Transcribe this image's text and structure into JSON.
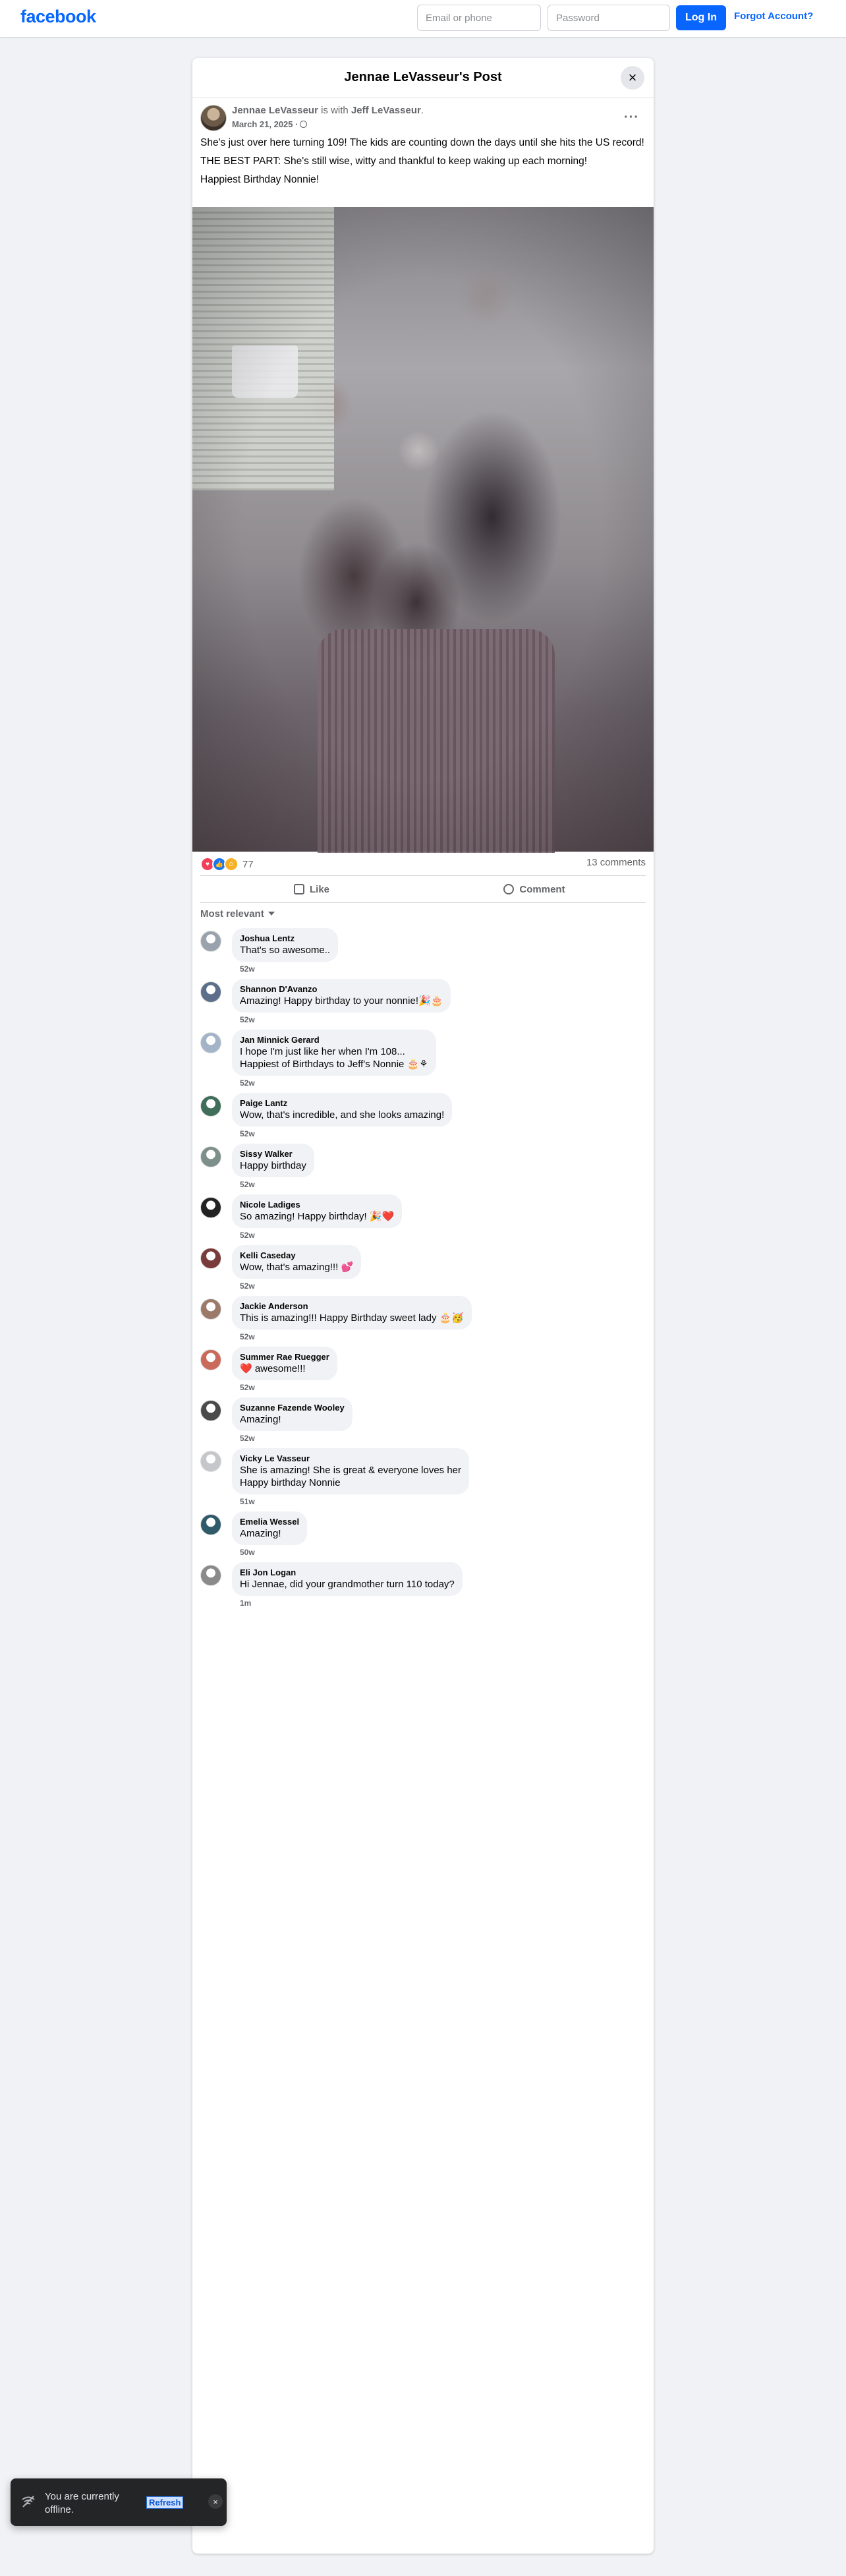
{
  "topbar": {
    "logo": "facebook",
    "email_placeholder": "Email or phone",
    "password_placeholder": "Password",
    "login_label": "Log In",
    "forgot_label": "Forgot Account?"
  },
  "post": {
    "header_title": "Jennae LeVasseur's Post",
    "close_icon": "×",
    "author": "Jennae LeVasseur",
    "with_text": " is with ",
    "tagged": "Jeff LeVasseur",
    "period": ".",
    "date": "March 21, 2025 ·",
    "more_icon": "···",
    "text_1": "She's just over here turning 109!  The kids are counting down the days until she hits the US record!",
    "text_2": "THE BEST PART: She's still wise, witty and thankful to keep waking up each morning!",
    "text_3": "Happiest Birthday Nonnie!",
    "reaction_count": "77",
    "comments_count": "13 comments",
    "like_label": "Like",
    "comment_label": "Comment",
    "sort_label": "Most relevant"
  },
  "comments": [
    {
      "name": "Joshua Lentz",
      "text": "That's so awesome..",
      "time": "52w"
    },
    {
      "name": "Shannon D'Avanzo",
      "text": "Amazing! Happy birthday to your nonnie!🎉🎂",
      "time": "52w"
    },
    {
      "name": "Jan Minnick Gerard",
      "text": "I hope I'm just like her when I'm 108...\nHappiest of Birthdays to Jeff's Nonnie 🎂⚘",
      "time": "52w"
    },
    {
      "name": "Paige Lantz",
      "text": "Wow, that's incredible, and she looks amazing!",
      "time": "52w"
    },
    {
      "name": "Sissy Walker",
      "text": "Happy birthday",
      "time": "52w"
    },
    {
      "name": "Nicole Ladiges",
      "text": "So amazing! Happy birthday! 🎉❤️",
      "time": "52w"
    },
    {
      "name": "Kelli Caseday",
      "text": "Wow, that's amazing!!! 💕",
      "time": "52w"
    },
    {
      "name": "Jackie Anderson",
      "text": "This is amazing!!! Happy Birthday sweet lady 🎂🥳",
      "time": "52w"
    },
    {
      "name": "Summer Rae Ruegger",
      "text": "❤️ awesome!!!",
      "time": "52w"
    },
    {
      "name": "Suzanne Fazende Wooley",
      "text": "Amazing!",
      "time": "52w"
    },
    {
      "name": "Vicky Le Vasseur",
      "text": "She is amazing! She is great & everyone loves her\nHappy birthday Nonnie",
      "time": "51w"
    },
    {
      "name": "Emelia Wessel",
      "text": "Amazing!",
      "time": "50w"
    },
    {
      "name": "Eli Jon Logan",
      "text": "Hi Jennae, did your grandmother turn 110 today?",
      "time": "1m"
    }
  ],
  "avatar_colors": [
    "#9aa3ad",
    "#5c6f8a",
    "#a3b4c8",
    "#3f6e5a",
    "#7d8f8a",
    "#222222",
    "#7a3b3b",
    "#9b7a6a",
    "#c96a5a",
    "#4a4a4a",
    "#c5c7ca",
    "#2f5a6a",
    "#8a8a8a"
  ],
  "toast": {
    "message": "You are currently offline.",
    "refresh_label": "Refresh",
    "close_icon": "×",
    "icon": "wifi-off-icon"
  }
}
